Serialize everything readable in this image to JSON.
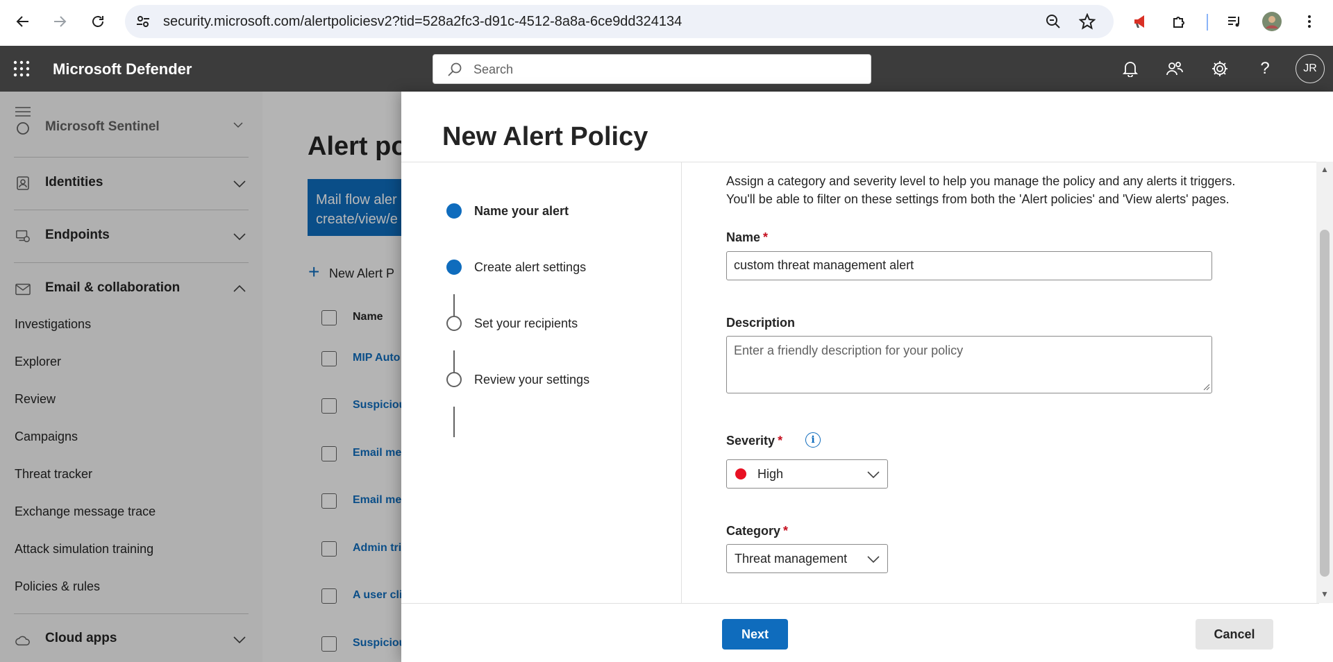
{
  "browser": {
    "url": "security.microsoft.com/alertpoliciesv2?tid=528a2fc3-d91c-4512-8a8a-6ce9dd324134"
  },
  "appbar": {
    "title": "Microsoft Defender",
    "search_placeholder": "Search",
    "avatar_initials": "JR",
    "avatar_color": "#3c3c3c"
  },
  "leftnav": {
    "partial_section": "Microsoft Sentinel",
    "sections": [
      {
        "label": "Identities",
        "icon": "identity-icon"
      },
      {
        "label": "Endpoints",
        "icon": "endpoint-icon"
      },
      {
        "label": "Email & collaboration",
        "icon": "mail-icon"
      }
    ],
    "email_items": [
      "Investigations",
      "Explorer",
      "Review",
      "Campaigns",
      "Threat tracker",
      "Exchange message trace",
      "Attack simulation training",
      "Policies & rules"
    ],
    "bottom_section": "Cloud apps"
  },
  "page": {
    "title": "Alert po",
    "banner_line1": "Mail flow aler",
    "banner_line2": "create/view/e",
    "new_alert": "New Alert P",
    "table_header": "Name",
    "rows": [
      "MIP Auto",
      "Suspiciou",
      "Email mes",
      "Email mes",
      "Admin tri",
      "A user cli",
      "Suspiciou"
    ]
  },
  "panel": {
    "title": "New Alert Policy",
    "steps": [
      {
        "label": "Name your alert",
        "state": "current"
      },
      {
        "label": "Create alert settings",
        "state": "filled"
      },
      {
        "label": "Set your recipients",
        "state": "empty"
      },
      {
        "label": "Review your settings",
        "state": "empty"
      }
    ],
    "intro_line1": "Assign a category and severity level to help you manage the policy and any alerts it triggers.",
    "intro_line2": "You'll be able to filter on these settings from both the 'Alert policies' and 'View alerts' pages.",
    "name_label": "Name",
    "name_value": "custom threat management alert",
    "description_label": "Description",
    "description_placeholder": "Enter a friendly description for your policy",
    "severity_label": "Severity",
    "severity_value": "High",
    "severity_color": "#e81123",
    "category_label": "Category",
    "category_value": "Threat management",
    "required_mark": "*",
    "next_label": "Next",
    "cancel_label": "Cancel",
    "accent_color": "#0f6cbd"
  }
}
